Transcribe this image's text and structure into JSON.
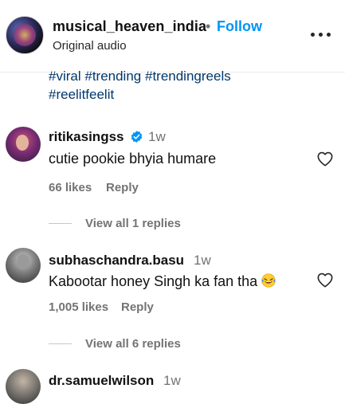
{
  "post": {
    "username": "musical_heaven_india",
    "separator": "•",
    "follow_label": "Follow",
    "audio_label": "Original audio"
  },
  "hashtags": [
    "#viral",
    "#trending",
    "#trendingreels",
    "#reelitfeelit"
  ],
  "comments": [
    {
      "username": "ritikasingss",
      "verified": true,
      "time": "1w",
      "text": "cutie pookie bhyia humare",
      "likes": "66 likes",
      "reply_label": "Reply",
      "view_replies": "View all 1 replies"
    },
    {
      "username": "subhaschandra.basu",
      "verified": false,
      "time": "1w",
      "text": "Kabootar honey Singh ka fan tha",
      "emoji": "laughing-tears",
      "likes": "1,005 likes",
      "reply_label": "Reply",
      "view_replies": "View all 6 replies"
    },
    {
      "username": "dr.samuelwilson",
      "verified": false,
      "time": "1w"
    }
  ],
  "icons": {
    "more": "more-horizontal-icon",
    "like": "heart-outline-icon",
    "verified": "verified-badge-icon"
  },
  "colors": {
    "follow": "#0095f6",
    "hashtag": "#00376b",
    "muted": "#737373",
    "verified": "#0095f6"
  }
}
